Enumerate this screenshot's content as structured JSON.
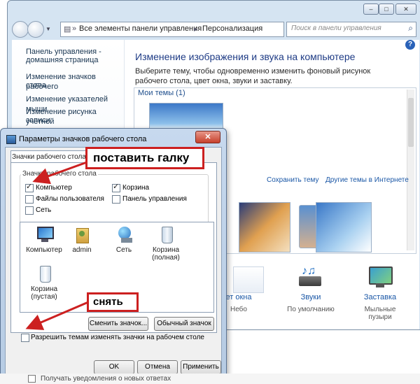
{
  "control_panel": {
    "address_segments": [
      "Все элементы панели управления",
      "Персонализация"
    ],
    "search_placeholder": "Поиск в панели управления",
    "side_links": [
      {
        "label": "Панель управления -"
      },
      {
        "label": "домашняя страница"
      },
      {
        "label": "Изменение значков рабочего"
      },
      {
        "label": "стола"
      },
      {
        "label": "Изменение указателей мыши"
      },
      {
        "label": "Изменение рисунка учетной"
      },
      {
        "label": "записи"
      }
    ],
    "title": "Изменение изображения и звука на компьютере",
    "description": "Выберите тему, чтобы одновременно изменить фоновый рисунок рабочего стола, цвет окна, звуки и заставку.",
    "my_themes_label": "Мои темы (1)",
    "save_theme": "Сохранить тему",
    "online_themes": "Другие темы в Интернете",
    "bottom_items": [
      {
        "label": "ет окна",
        "sub": "Небо"
      },
      {
        "label": "Звуки",
        "sub": "По умолчанию"
      },
      {
        "label": "Заставка",
        "sub": "Мыльные пузыри"
      }
    ],
    "help_icon": "question-icon"
  },
  "dialog": {
    "title": "Параметры значков рабочего стола",
    "tab_label": "Значки рабочего стола",
    "group_label": "Значки рабочего стола",
    "checkboxes": [
      {
        "label": "Компьютер",
        "checked": true
      },
      {
        "label": "Корзина",
        "checked": true
      },
      {
        "label": "Файлы пользователя",
        "checked": false
      },
      {
        "label": "Панель управления",
        "checked": false
      },
      {
        "label": "Сеть",
        "checked": false
      }
    ],
    "icons": [
      {
        "label": "Компьютер"
      },
      {
        "label": "admin"
      },
      {
        "label": "Сеть"
      },
      {
        "label": "Корзина (полная)"
      },
      {
        "label": "Корзина (пустая)"
      }
    ],
    "change_icon_button": "Сменить значок...",
    "default_icon_button": "Обычный значок",
    "allow_themes_label": "Разрешить темам изменять значки на рабочем столе",
    "allow_themes_checked": false,
    "ok_button": "OK",
    "cancel_button": "Отмена",
    "apply_button": "Применить"
  },
  "annotations": {
    "callout_check": "поставить галку",
    "callout_uncheck": "снять",
    "arrow_color": "#cc2020"
  },
  "background_text": "Получать уведомления о новых ответах"
}
